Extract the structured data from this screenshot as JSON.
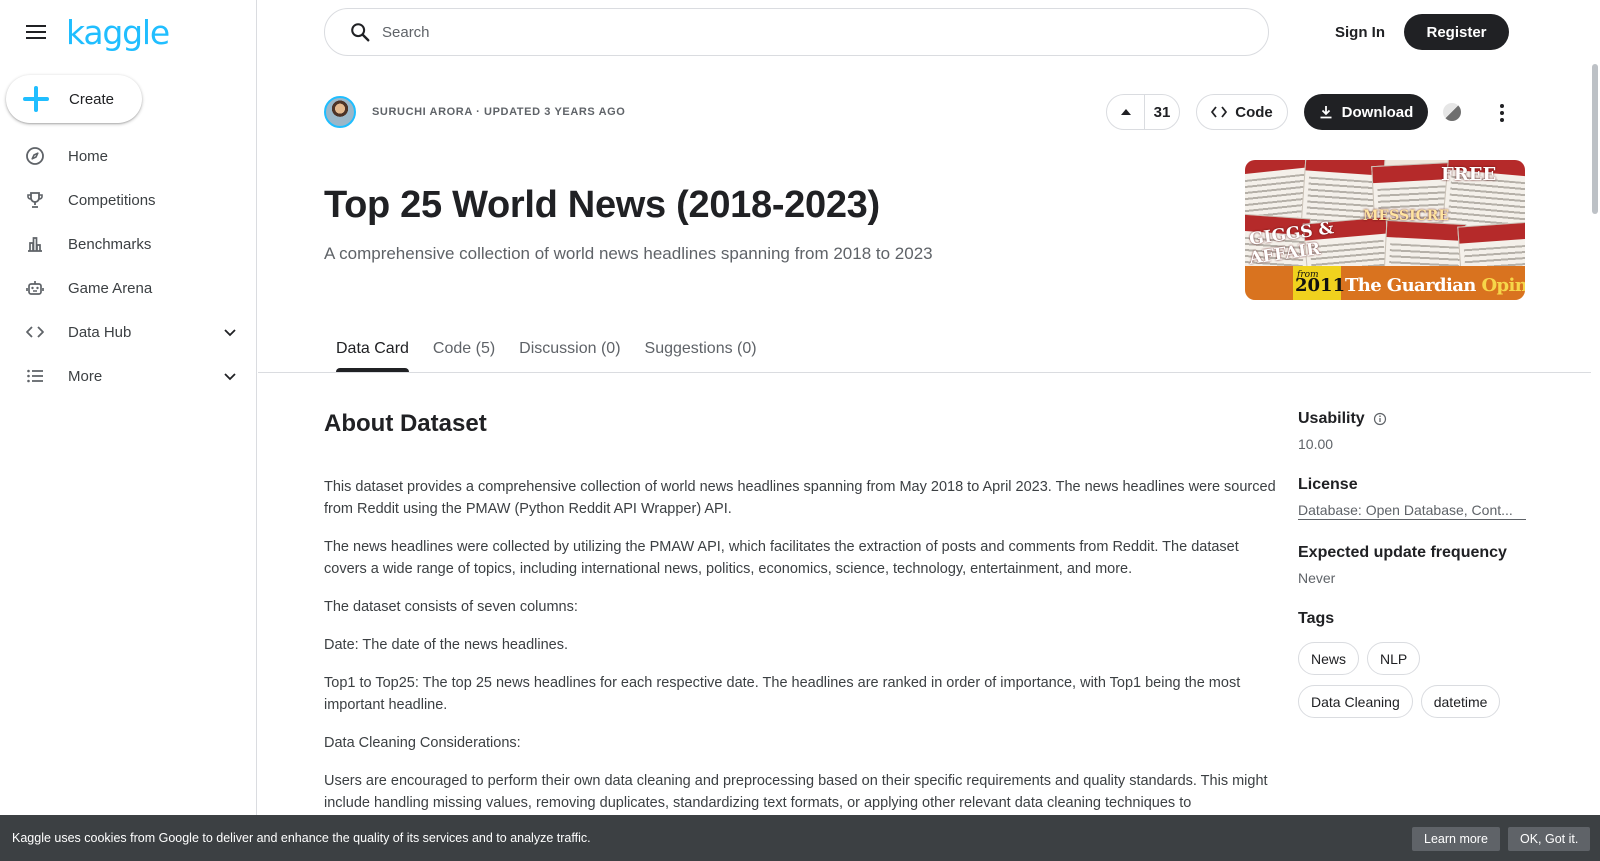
{
  "sidebar": {
    "logo": "kaggle",
    "create_label": "Create",
    "items": [
      {
        "label": "Home",
        "icon": "compass-icon"
      },
      {
        "label": "Competitions",
        "icon": "trophy-icon"
      },
      {
        "label": "Benchmarks",
        "icon": "bar-chart-icon"
      },
      {
        "label": "Game Arena",
        "icon": "robot-icon"
      },
      {
        "label": "Data Hub",
        "icon": "code-brackets-icon",
        "expandable": true
      },
      {
        "label": "More",
        "icon": "list-icon",
        "expandable": true
      }
    ]
  },
  "topbar": {
    "search_placeholder": "Search",
    "signin_label": "Sign In",
    "register_label": "Register"
  },
  "dataset": {
    "byline": "Suruchi Arora · Updated 3 years ago",
    "vote_count": "31",
    "code_label": "Code",
    "download_label": "Download",
    "title": "Top 25 World News (2018-2023)",
    "subtitle": "A comprehensive collection of world news headlines spanning from 2018 to 2023",
    "cover": {
      "headline_1": "GIGGS &",
      "headline_2": "AFFAIR",
      "headline_3": "MESSICRE",
      "headline_4": "FREE",
      "from": "from",
      "year": "2011",
      "brand": "The Guardian",
      "brand_suffix": "Opinions"
    }
  },
  "tabs": [
    {
      "label": "Data Card",
      "active": true
    },
    {
      "label": "Code (5)",
      "active": false
    },
    {
      "label": "Discussion (0)",
      "active": false
    },
    {
      "label": "Suggestions (0)",
      "active": false
    }
  ],
  "about": {
    "heading": "About Dataset",
    "paragraphs": [
      "This dataset provides a comprehensive collection of world news headlines spanning from May 2018 to April 2023. The news headlines were sourced from Reddit using the PMAW (Python Reddit API Wrapper) API.",
      "The news headlines were collected by utilizing the PMAW API, which facilitates the extraction of posts and comments from Reddit. The dataset covers a wide range of topics, including international news, politics, economics, science, technology, entertainment, and more.",
      "The dataset consists of seven columns:",
      "Date: The date of the news headlines.",
      "Top1 to Top25: The top 25 news headlines for each respective date. The headlines are ranked in order of importance, with Top1 being the most important headline.",
      "Data Cleaning Considerations:",
      "Users are encouraged to perform their own data cleaning and preprocessing based on their specific requirements and quality standards. This might include handling missing values, removing duplicates, standardizing text formats, or applying other relevant data cleaning techniques to"
    ]
  },
  "meta": {
    "usability_label": "Usability",
    "usability_value": "10.00",
    "license_label": "License",
    "license_value": "Database: Open Database, Cont...",
    "frequency_label": "Expected update frequency",
    "frequency_value": "Never",
    "tags_label": "Tags",
    "tags": [
      "News",
      "NLP",
      "Data Cleaning",
      "datetime"
    ]
  },
  "cookie": {
    "text": "Kaggle uses cookies from Google to deliver and enhance the quality of its services and to analyze traffic.",
    "learn_more": "Learn more",
    "ok": "OK, Got it."
  },
  "colors": {
    "brand": "#20beff",
    "dark": "#202124",
    "muted": "#5f6368",
    "border": "#dadce0",
    "cookie_bg": "#3c4043"
  }
}
